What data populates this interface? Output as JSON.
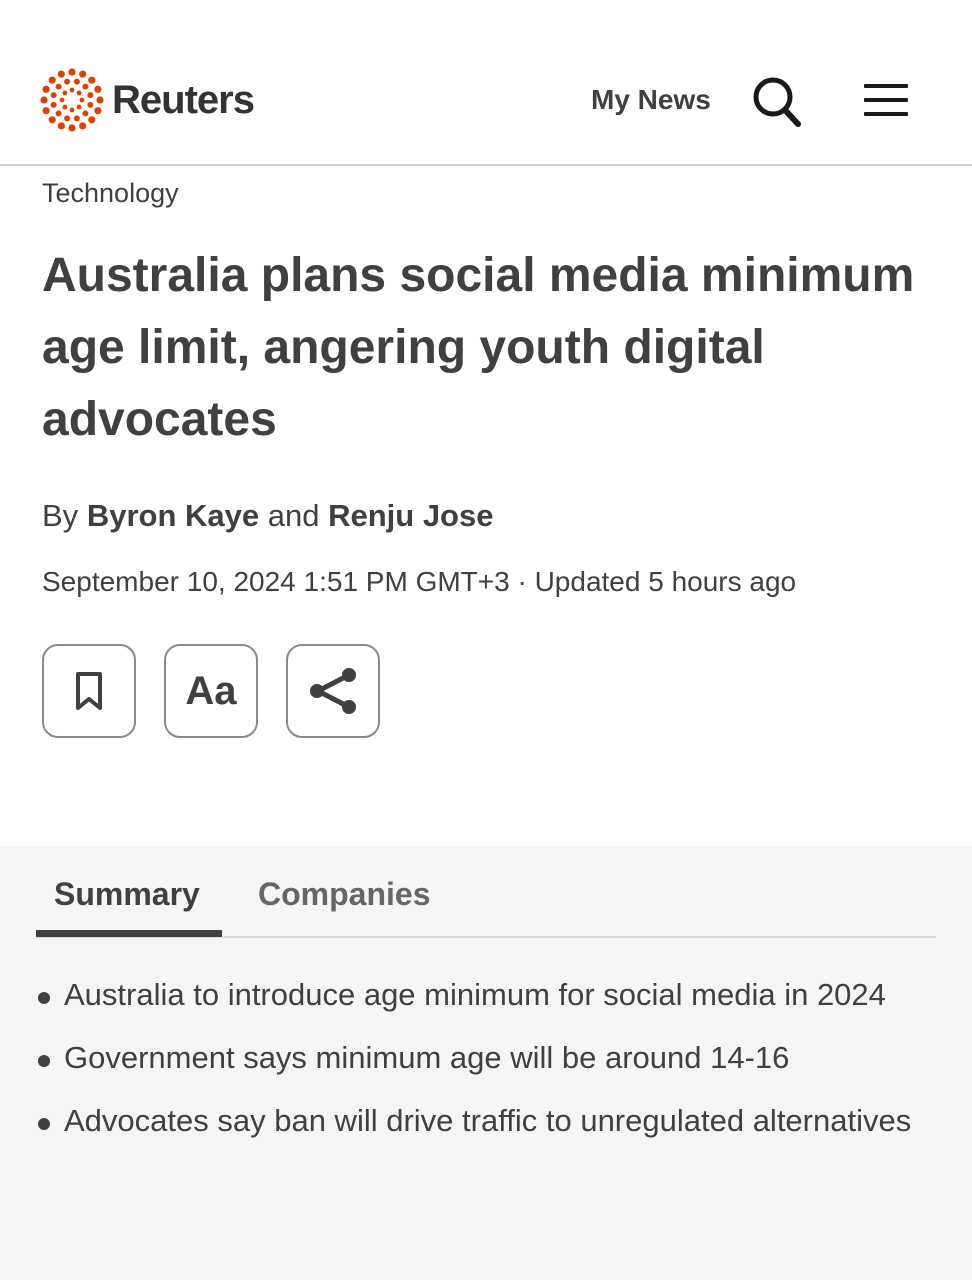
{
  "header": {
    "brand": "Reuters",
    "my_news": "My News",
    "search_icon": "search-icon",
    "menu_icon": "hamburger-menu-icon",
    "logo_color": "#dc4300"
  },
  "article": {
    "section": "Technology",
    "headline": "Australia plans social media minimum age limit, angering youth digital advocates",
    "byline_prefix": "By",
    "author1": "Byron Kaye",
    "byline_and": "and",
    "author2": "Renju Jose",
    "date": "September 10, 2024 1:51 PM GMT+3 · Updated 5 hours ago"
  },
  "actions": {
    "bookmark_icon": "bookmark-icon",
    "text_size_label": "Aa",
    "share_icon": "share-icon"
  },
  "summary": {
    "tabs": [
      "Summary",
      "Companies"
    ],
    "active_tab": "Summary",
    "bullets": [
      "Australia to introduce age minimum for social media in 2024",
      "Government says minimum age will be around 14-16",
      "Advocates say ban will drive traffic to unregulated alternatives"
    ]
  }
}
